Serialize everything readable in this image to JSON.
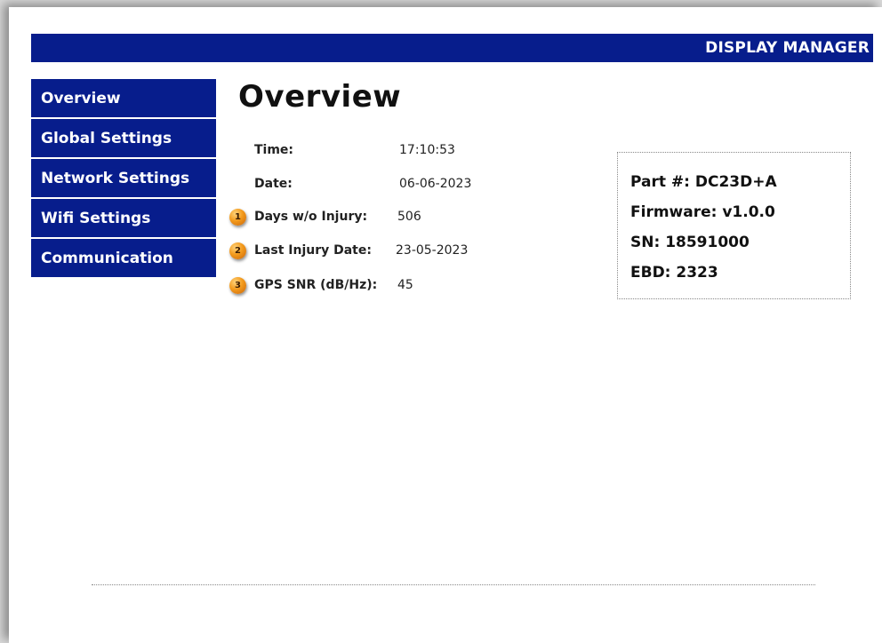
{
  "header": {
    "title": "DISPLAY MANAGER"
  },
  "sidebar": {
    "items": [
      {
        "label": "Overview"
      },
      {
        "label": "Global Settings"
      },
      {
        "label": "Network Settings"
      },
      {
        "label": "Wifi Settings"
      },
      {
        "label": "Communication"
      }
    ]
  },
  "main": {
    "title": "Overview",
    "rows": [
      {
        "label": "Time:",
        "value": "17:10:53"
      },
      {
        "label": "Date:",
        "value": "06-06-2023"
      },
      {
        "badge": "1",
        "label": "Days w/o Injury:",
        "value": "506"
      },
      {
        "badge": "2",
        "label": "Last Injury Date:",
        "value": "23-05-2023"
      },
      {
        "badge": "3",
        "label": "GPS SNR (dB/Hz):",
        "value": "45"
      }
    ]
  },
  "device_info": {
    "lines": [
      "Part #:  DC23D+A",
      "Firmware:  v1.0.0",
      "SN: 18591000",
      "EBD: 2323"
    ]
  },
  "colors": {
    "nav_bg": "#071d8c",
    "badge": "#f39a1c"
  }
}
